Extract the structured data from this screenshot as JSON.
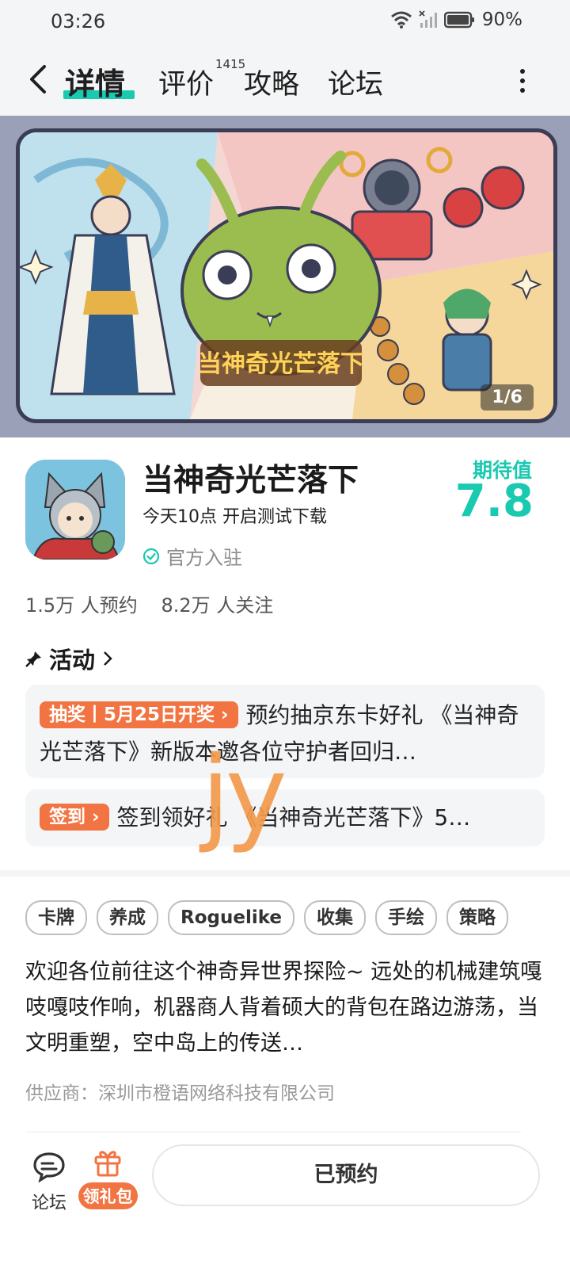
{
  "status_bar": {
    "time": "03:26",
    "battery": "90%",
    "icons": [
      "wifi-icon",
      "signal-icon",
      "battery-icon"
    ]
  },
  "nav": {
    "tabs": [
      {
        "label": "详情",
        "active": true
      },
      {
        "label": "评价",
        "badge": "1415"
      },
      {
        "label": "攻略"
      },
      {
        "label": "论坛"
      }
    ]
  },
  "banner": {
    "counter": "1/6",
    "logo_text": "当神奇光芒落下"
  },
  "app": {
    "name": "当神奇光芒落下",
    "subtitle": "今天10点 开启测试下载",
    "verified": "官方入驻",
    "expect_label": "期待值",
    "expect_value": "7.8"
  },
  "stats": {
    "reservations": "1.5万 人预约",
    "followers": "8.2万 人关注"
  },
  "activity": {
    "title": "活动",
    "items": [
      {
        "tag": "抽奖丨5月25日开奖",
        "text": "预约抽京东卡好礼 《当神奇光芒落下》新版本邀各位守护者回归…"
      },
      {
        "tag": "签到",
        "text": "签到领好礼 《当神奇光芒落下》5…"
      }
    ]
  },
  "watermark": "jy",
  "tags": [
    "卡牌",
    "养成",
    "Roguelike",
    "收集",
    "手绘",
    "策略"
  ],
  "description": "欢迎各位前往这个神奇异世界探险~ 远处的机械建筑嘎吱嘎吱作响，机器商人背着硕大的背包在路边游荡，当文明重塑，空中岛上的传送…",
  "supplier": "供应商：深圳市橙语网络科技有限公司",
  "bottom": {
    "forum_label": "论坛",
    "gift_label": "领礼包",
    "reserve_label": "已预约"
  },
  "colors": {
    "accent": "#19c9b0",
    "orange": "#f27442"
  }
}
